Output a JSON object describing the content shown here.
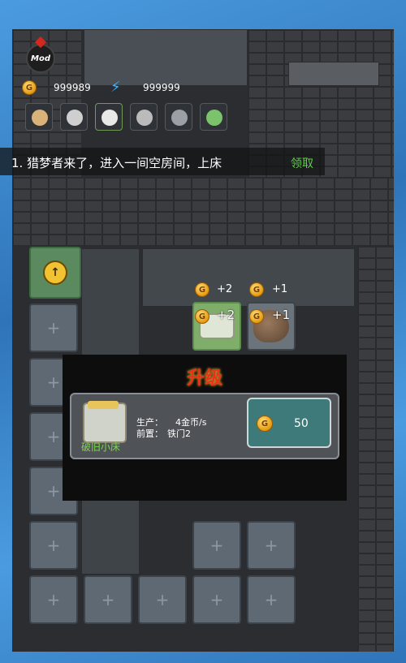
{
  "app": {
    "badge": "Mod"
  },
  "hud": {
    "coins": "999989",
    "energy": "999999"
  },
  "avatars": [
    {
      "name": "hunter-avatar-1",
      "color": "#d9b27a"
    },
    {
      "name": "hunter-avatar-2",
      "color": "#cfcfcf"
    },
    {
      "name": "hunter-avatar-3",
      "color": "#e8e8e8"
    },
    {
      "name": "hunter-avatar-4",
      "color": "#bbbbbb"
    },
    {
      "name": "hunter-avatar-5",
      "color": "#9aa0a6"
    },
    {
      "name": "hunter-avatar-6",
      "color": "#7bc46b"
    }
  ],
  "quest": {
    "text": "1. 猎梦者来了，进入一间空房间，上床",
    "claim_label": "领取"
  },
  "board": {
    "income_a": "+2",
    "income_b": "+1",
    "float_a": "+2",
    "float_b": "+1",
    "empty_cell_symbol": "+"
  },
  "upgrade_modal": {
    "title": "升级",
    "item_name": "破旧小床",
    "production_label": "生产：",
    "production_value": "4金币/s",
    "prereq_label": "前置：",
    "prereq_value": "铁门2",
    "cost": "50"
  },
  "colors": {
    "accent_gold": "#f0a020",
    "title_red": "#e8321a",
    "claim_green": "#5fcf4a"
  }
}
